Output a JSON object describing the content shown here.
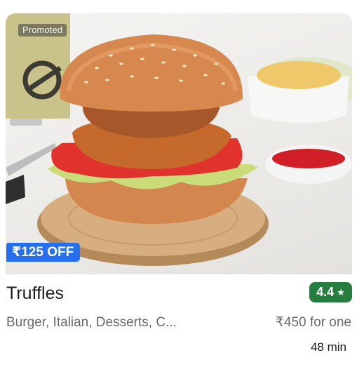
{
  "badges": {
    "promoted": "Promoted",
    "offer": "₹125 OFF"
  },
  "restaurant": {
    "name": "Truffles",
    "rating": "4.4",
    "rating_icon": "star-icon",
    "cuisines": "Burger, Italian, Desserts, C...",
    "price": "₹450 for one",
    "delivery_time": "48 min"
  },
  "colors": {
    "offer_badge": "#256fef",
    "rating_badge": "#267e3e",
    "secondary_text": "#696969"
  },
  "image": {
    "subject": "burger-photo"
  }
}
